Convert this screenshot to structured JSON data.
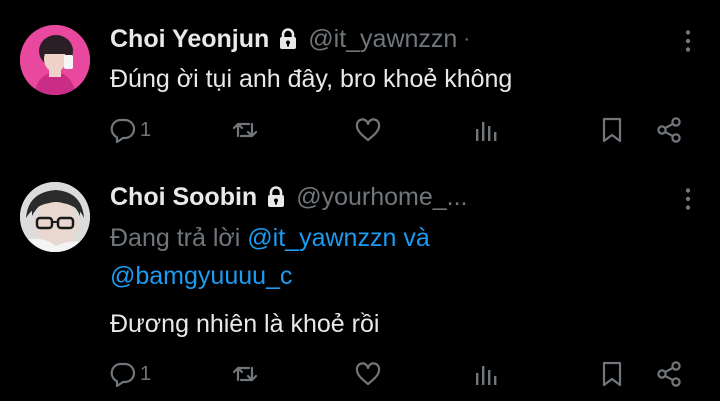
{
  "tweets": [
    {
      "display_name": "Choi Yeonjun",
      "handle": "@it_yawnzzn",
      "separator": "·",
      "text": "Đúng ời tụi anh đây, bro khoẻ không",
      "reply_count": "1",
      "avatar_description": "profile photo, pink background"
    },
    {
      "display_name": "Choi Soobin",
      "handle": "@yourhome_...",
      "separator": "·",
      "replying_prefix": "Đang trả lời",
      "replying_user_1": "@it_yawnzzn",
      "replying_join": "và",
      "replying_user_2": "@bamgyuuuu_c",
      "text": "Đương nhiên là khoẻ rồi",
      "reply_count": "1",
      "avatar_description": "profile photo, person with glasses"
    }
  ],
  "colors": {
    "background": "#000000",
    "primary_text": "#e7e9ea",
    "secondary_text": "#71767b",
    "link": "#1d9bf0"
  },
  "icons": [
    "lock-icon",
    "more-icon",
    "reply-icon",
    "retweet-icon",
    "like-icon",
    "views-icon",
    "bookmark-icon",
    "share-icon"
  ]
}
